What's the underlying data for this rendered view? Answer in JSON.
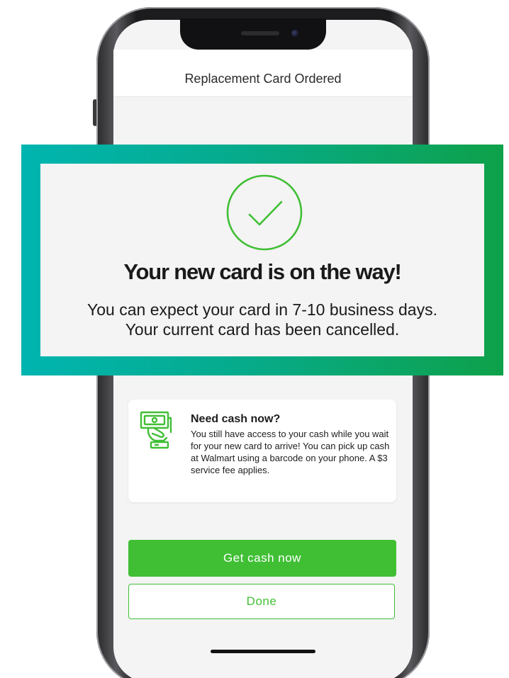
{
  "screen": {
    "title": "Replacement Card Ordered"
  },
  "confirmation": {
    "icon": "check-circle-icon",
    "headline": "Your new card is on the way!",
    "line1": "You can expect your card in 7-10 business days.",
    "line2": "Your current card has been cancelled."
  },
  "cash_card": {
    "icon": "cash-hand-icon",
    "title": "Need cash now?",
    "body": "You still have access to your cash while you wait for your new card to arrive! You can pick up cash at Walmart using a barcode on your phone. A $3 service fee applies."
  },
  "actions": {
    "primary_label": "Get cash now",
    "secondary_label": "Done"
  },
  "colors": {
    "accent_green": "#40bf35",
    "highlight_start": "#00b5b0",
    "highlight_end": "#0ea14a"
  }
}
